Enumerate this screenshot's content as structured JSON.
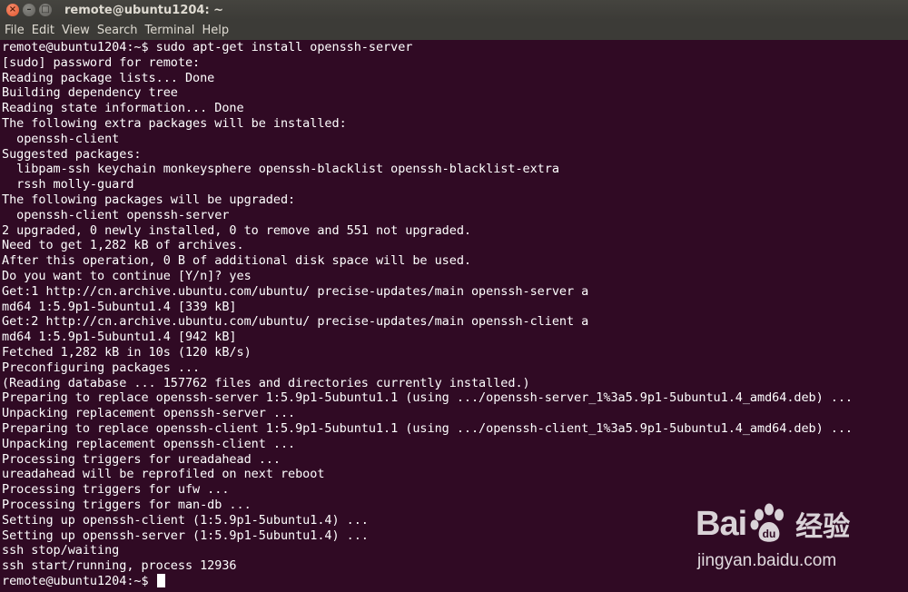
{
  "window": {
    "title": "remote@ubuntu1204: ~",
    "close_glyph": "×",
    "min_glyph": "–",
    "max_glyph": "□"
  },
  "menu": [
    "File",
    "Edit",
    "View",
    "Search",
    "Terminal",
    "Help"
  ],
  "terminal": {
    "lines": [
      "remote@ubuntu1204:~$ sudo apt-get install openssh-server",
      "[sudo] password for remote:",
      "Reading package lists... Done",
      "Building dependency tree",
      "Reading state information... Done",
      "The following extra packages will be installed:",
      "  openssh-client",
      "Suggested packages:",
      "  libpam-ssh keychain monkeysphere openssh-blacklist openssh-blacklist-extra",
      "  rssh molly-guard",
      "The following packages will be upgraded:",
      "  openssh-client openssh-server",
      "2 upgraded, 0 newly installed, 0 to remove and 551 not upgraded.",
      "Need to get 1,282 kB of archives.",
      "After this operation, 0 B of additional disk space will be used.",
      "Do you want to continue [Y/n]? yes",
      "Get:1 http://cn.archive.ubuntu.com/ubuntu/ precise-updates/main openssh-server a",
      "md64 1:5.9p1-5ubuntu1.4 [339 kB]",
      "Get:2 http://cn.archive.ubuntu.com/ubuntu/ precise-updates/main openssh-client a",
      "md64 1:5.9p1-5ubuntu1.4 [942 kB]",
      "Fetched 1,282 kB in 10s (120 kB/s)",
      "Preconfiguring packages ...",
      "(Reading database ... 157762 files and directories currently installed.)",
      "Preparing to replace openssh-server 1:5.9p1-5ubuntu1.1 (using .../openssh-server_1%3a5.9p1-5ubuntu1.4_amd64.deb) ...",
      "Unpacking replacement openssh-server ...",
      "Preparing to replace openssh-client 1:5.9p1-5ubuntu1.1 (using .../openssh-client_1%3a5.9p1-5ubuntu1.4_amd64.deb) ...",
      "Unpacking replacement openssh-client ...",
      "Processing triggers for ureadahead ...",
      "ureadahead will be reprofiled on next reboot",
      "Processing triggers for ufw ...",
      "Processing triggers for man-db ...",
      "Setting up openssh-client (1:5.9p1-5ubuntu1.4) ...",
      "Setting up openssh-server (1:5.9p1-5ubuntu1.4) ...",
      "ssh stop/waiting",
      "ssh start/running, process 12936"
    ],
    "prompt": "remote@ubuntu1204:~$ ",
    "background": "#300a24",
    "foreground": "#ffffff"
  },
  "watermark": {
    "brand_left": "Bai",
    "brand_right": "经验",
    "url": "jingyan.baidu.com"
  }
}
